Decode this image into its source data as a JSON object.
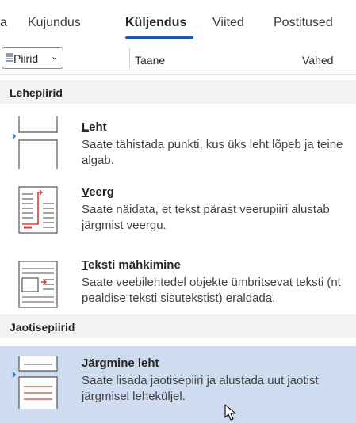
{
  "ribbon": {
    "tabs": [
      {
        "label": "a"
      },
      {
        "label": "Kujundus"
      },
      {
        "label": "Küljendus",
        "active": true
      },
      {
        "label": "Viited"
      },
      {
        "label": "Postitused"
      }
    ]
  },
  "toolbar": {
    "piirid_label": "Piirid",
    "taane_label": "Taane",
    "vahed_label": "Vahed"
  },
  "menu": {
    "lehepiirid_header": "Lehepiirid",
    "jaotisepiirid_header": "Jaotisepiirid",
    "items": [
      {
        "accel": "L",
        "title_rest": "eht",
        "description": "Saate tähistada punkti, kus üks leht lõpeb ja teine algab."
      },
      {
        "accel": "V",
        "title_rest": "eerg",
        "description": "Saate näidata, et tekst pärast veerupiiri alustab järgmist veergu."
      },
      {
        "accel": "T",
        "title_rest": "eksti mähkimine",
        "description": "Saate veebilehtedel objekte ümbritsevat teksti (nt pealdise teksti sisutekstist) eraldada."
      },
      {
        "accel": "J",
        "title_rest": "ärgmine leht",
        "description": "Saate lisada jaotisepiiri ja alustada uut jaotist järgmisel leheküljel.",
        "hovered": true
      }
    ]
  },
  "colors": {
    "accent": "#185abd",
    "hover_bg": "#cfdcef",
    "break_red": "#e23b3b",
    "icon_blue": "#1e6ed0"
  }
}
